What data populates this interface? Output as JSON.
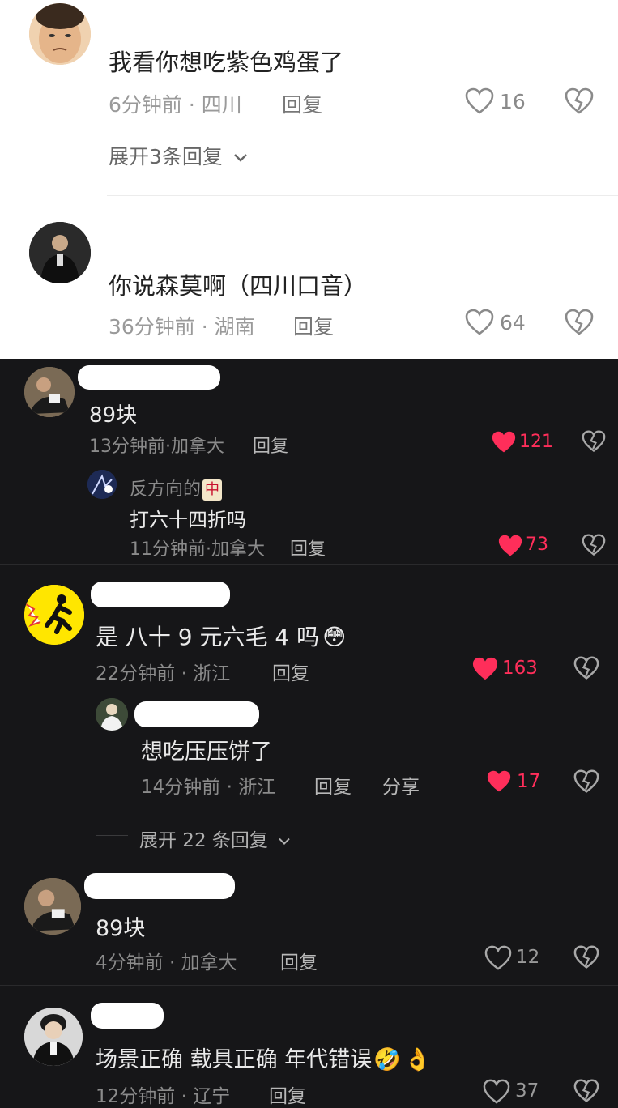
{
  "light_comments": [
    {
      "text": "我看你想吃紫色鸡蛋了",
      "meta": "6分钟前 · 四川",
      "reply": "回复",
      "likes": "16",
      "expand": "展开3条回复"
    },
    {
      "text": "你说森莫啊（四川口音）",
      "meta": "36分钟前 · 湖南",
      "reply": "回复",
      "likes": "64"
    }
  ],
  "dark_comments": [
    {
      "text": "89块",
      "meta": "13分钟前·加拿大",
      "reply": "回复",
      "likes": "121"
    },
    {
      "name": "反方向的",
      "name_emoji": "🀄",
      "text": "打六十四折吗",
      "meta": "11分钟前·加拿大",
      "reply": "回复",
      "likes": "73"
    },
    {
      "text": "是 八十 9 元六毛 4 吗",
      "emoji": "😳",
      "meta": "22分钟前 · 浙江",
      "reply": "回复",
      "likes": "163"
    },
    {
      "text": "想吃压压饼了",
      "meta": "14分钟前 · 浙江",
      "reply": "回复",
      "share": "分享",
      "likes": "17"
    },
    {
      "expand": "展开 22 条回复"
    },
    {
      "text": "89块",
      "meta": "4分钟前 · 加拿大",
      "reply": "回复",
      "likes": "12"
    },
    {
      "text": "场景正确 载具正确 年代错误",
      "emoji1": "🤣",
      "emoji2": "👌",
      "meta": "12分钟前 · 辽宁",
      "reply": "回复",
      "likes": "37"
    }
  ],
  "colors": {
    "like_red": "#ff2e5a",
    "light_bg": "#ffffff",
    "dark_bg": "#161618"
  }
}
